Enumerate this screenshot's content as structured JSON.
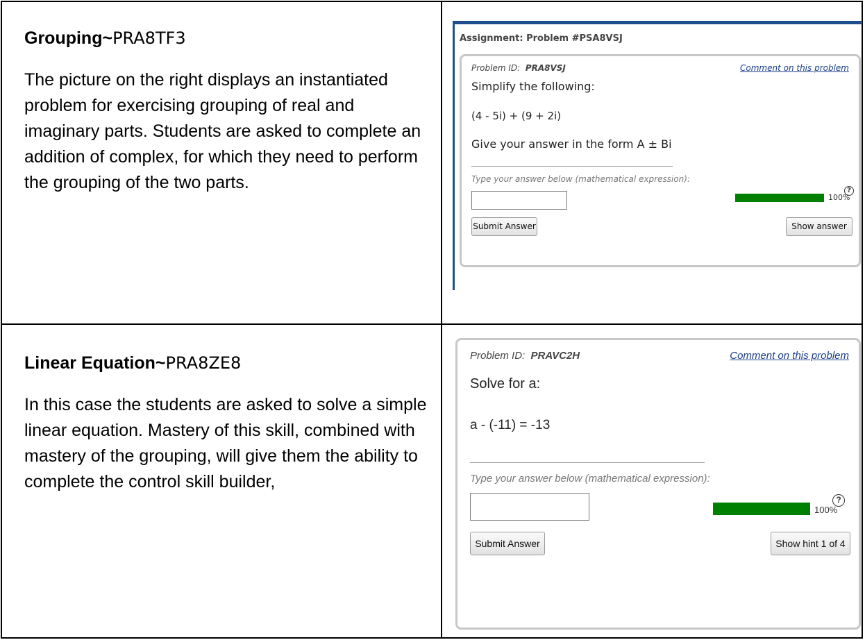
{
  "rows": [
    {
      "title_bold": "Grouping~",
      "title_code": "PRA8TF3",
      "body": "The picture on the right displays an instantiated problem for exercising grouping of real and imaginary parts. Students are asked to complete an addition of complex, for which they need to perform the grouping of the two parts.",
      "screenshot": {
        "header": "Assignment: Problem #PSA8VSJ",
        "problem_id_label": "Problem ID:",
        "problem_id": "PRA8VSJ",
        "comment_link": "Comment on this problem",
        "question_title": "Simplify the following:",
        "expression": "(4 - 5i) + (9 + 2i)",
        "answer_form": "Give your answer in the form A ± Bi",
        "input_hint": "Type your answer below (mathematical expression):",
        "input_value": "",
        "progress_percent": 100,
        "progress_label": "100%",
        "help_icon": "question-circle-icon",
        "submit_label": "Submit Answer",
        "secondary_button_label": "Show answer"
      }
    },
    {
      "title_bold": "Linear Equation~",
      "title_code": "PRA8ZE8",
      "body": "In this case the students are asked to solve a simple linear equation. Mastery of this skill, combined with mastery of the grouping, will give them the ability to complete the control skill builder,",
      "screenshot": {
        "problem_id_label": "Problem ID:",
        "problem_id": "PRAVC2H",
        "comment_link": "Comment on this problem",
        "question_title": "Solve for a:",
        "expression": "a - (-11) = -13",
        "input_hint": "Type your answer below (mathematical expression):",
        "input_value": "",
        "progress_percent": 100,
        "progress_label": "100%",
        "help_icon": "question-circle-icon",
        "submit_label": "Submit Answer",
        "secondary_button_label": "Show hint 1 of 4"
      }
    }
  ],
  "colors": {
    "accent_blue": "#1f4e8f",
    "progress_green": "#008000",
    "link_blue": "#1a3d8f"
  }
}
